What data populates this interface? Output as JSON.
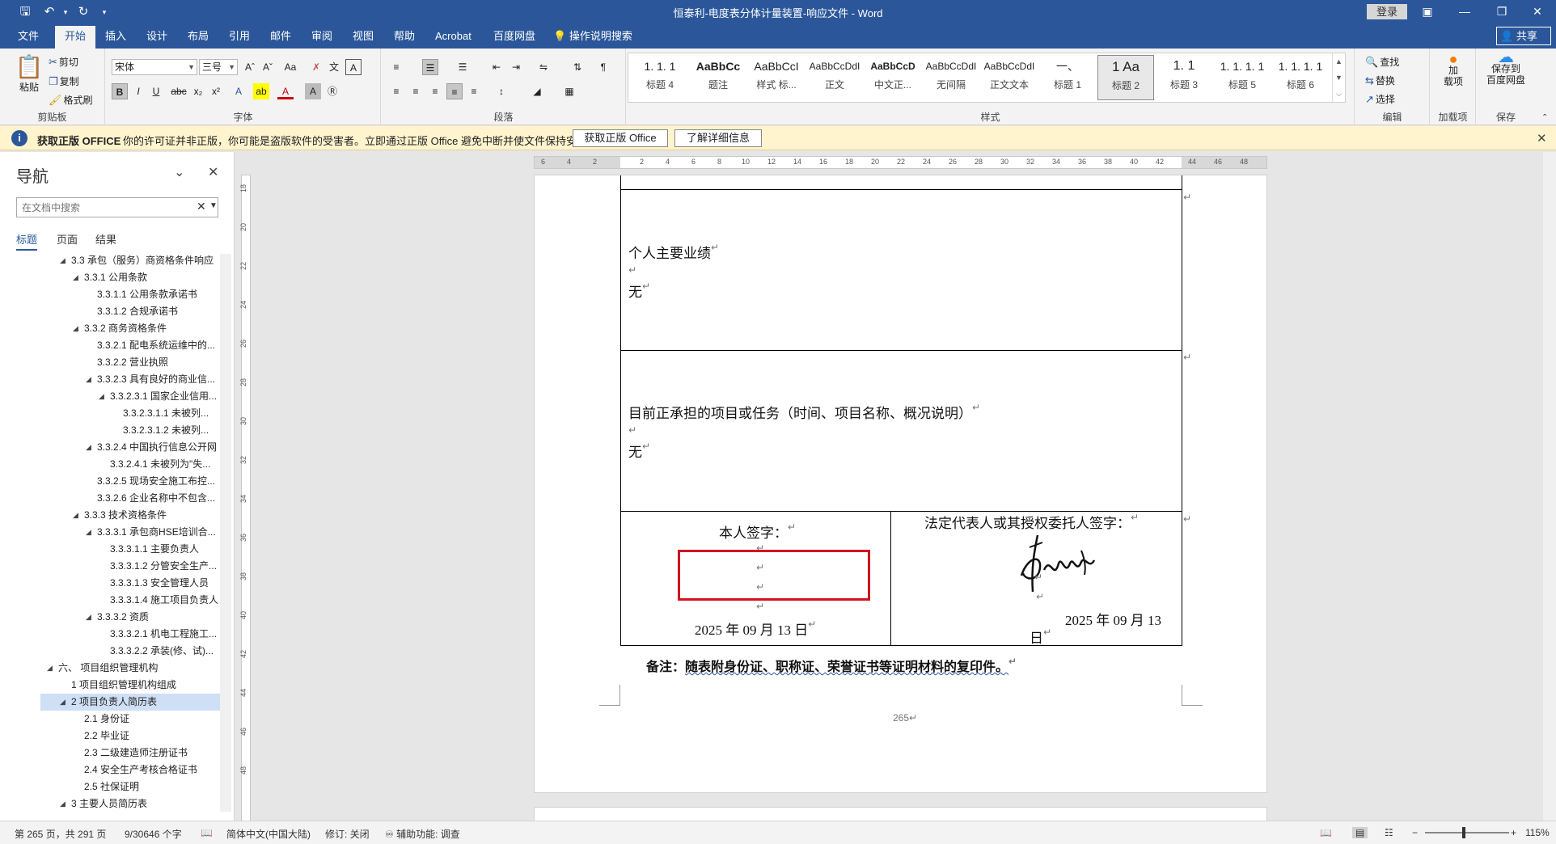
{
  "title": "恒泰利-电度表分体计量装置-响应文件  -  Word",
  "login": "登录",
  "share": "共享",
  "tabs": [
    "文件",
    "开始",
    "插入",
    "设计",
    "布局",
    "引用",
    "邮件",
    "审阅",
    "视图",
    "帮助",
    "Acrobat",
    "百度网盘",
    "操作说明搜索"
  ],
  "ribbon": {
    "clipboard": {
      "paste": "粘贴",
      "cut": "剪切",
      "copy": "复制",
      "painter": "格式刷",
      "label": "剪贴板"
    },
    "font": {
      "name": "宋体",
      "size": "三号",
      "label": "字体"
    },
    "paragraph": {
      "label": "段落"
    },
    "styles": {
      "label": "样式",
      "items": [
        {
          "preview": "1. 1. 1",
          "name": "标题 4"
        },
        {
          "preview": "AaBbCc",
          "name": "题注"
        },
        {
          "preview": "AaBbCcI",
          "name": "样式 标..."
        },
        {
          "preview": "AaBbCcDdI",
          "name": "正文"
        },
        {
          "preview": "AaBbCcD",
          "name": "中文正..."
        },
        {
          "preview": "AaBbCcDdI",
          "name": "无间隔"
        },
        {
          "preview": "AaBbCcDdI",
          "name": "正文文本"
        },
        {
          "preview": "一、",
          "name": "标题 1"
        },
        {
          "preview": "1  Aa",
          "name": "标题 2"
        },
        {
          "preview": "1. 1",
          "name": "标题 3"
        },
        {
          "preview": "1. 1. 1. 1",
          "name": "标题 5"
        },
        {
          "preview": "1. 1. 1. 1",
          "name": "标题 6"
        }
      ]
    },
    "editing": {
      "find": "查找",
      "replace": "替换",
      "select": "选择",
      "label": "编辑"
    },
    "addins": {
      "button": "加\n载项",
      "label": "加载项"
    },
    "save": {
      "button": "保存到\n百度网盘",
      "label": "保存"
    }
  },
  "infobar": {
    "title": "获取正版 OFFICE",
    "message": "你的许可证并非正版，你可能是盗版软件的受害者。立即通过正版 Office 避免中断并使文件保持安全。",
    "btn1": "获取正版 Office",
    "btn2": "了解详细信息"
  },
  "nav": {
    "title": "导航",
    "search_placeholder": "在文档中搜索",
    "tabs": [
      "标题",
      "页面",
      "结果"
    ],
    "items": [
      {
        "t": "3.3 承包（服务）商资格条件响应",
        "lv": 1,
        "tri": true
      },
      {
        "t": "3.3.1 公用条款",
        "lv": 2,
        "tri": true
      },
      {
        "t": "3.3.1.1 公用条款承诺书",
        "lv": 3,
        "tri": false
      },
      {
        "t": "3.3.1.2 合规承诺书",
        "lv": 3,
        "tri": false
      },
      {
        "t": "3.3.2 商务资格条件",
        "lv": 2,
        "tri": true
      },
      {
        "t": "3.3.2.1 配电系统运维中的...",
        "lv": 3,
        "tri": false
      },
      {
        "t": "3.3.2.2 营业执照",
        "lv": 3,
        "tri": false
      },
      {
        "t": "3.3.2.3 具有良好的商业信...",
        "lv": 3,
        "tri": true
      },
      {
        "t": "3.3.2.3.1 国家企业信用...",
        "lv": 4,
        "tri": true
      },
      {
        "t": "3.3.2.3.1.1 未被列...",
        "lv": 5,
        "tri": false
      },
      {
        "t": "3.3.2.3.1.2 未被列...",
        "lv": 5,
        "tri": false
      },
      {
        "t": "3.3.2.4 中国执行信息公开网",
        "lv": 3,
        "tri": true
      },
      {
        "t": "3.3.2.4.1 未被列为\"失...",
        "lv": 4,
        "tri": false
      },
      {
        "t": "3.3.2.5 现场安全施工布控...",
        "lv": 3,
        "tri": false
      },
      {
        "t": "3.3.2.6 企业名称中不包含...",
        "lv": 3,
        "tri": false
      },
      {
        "t": "3.3.3 技术资格条件",
        "lv": 2,
        "tri": true
      },
      {
        "t": "3.3.3.1 承包商HSE培训合...",
        "lv": 3,
        "tri": true
      },
      {
        "t": "3.3.3.1.1 主要负责人",
        "lv": 4,
        "tri": false
      },
      {
        "t": "3.3.3.1.2 分管安全生产...",
        "lv": 4,
        "tri": false
      },
      {
        "t": "3.3.3.1.3 安全管理人员",
        "lv": 4,
        "tri": false
      },
      {
        "t": "3.3.3.1.4 施工项目负责人",
        "lv": 4,
        "tri": false
      },
      {
        "t": "3.3.3.2 资质",
        "lv": 3,
        "tri": true
      },
      {
        "t": "3.3.3.2.1 机电工程施工...",
        "lv": 4,
        "tri": false
      },
      {
        "t": "3.3.3.2.2 承装(修、试)...",
        "lv": 4,
        "tri": false
      },
      {
        "t": "六、 项目组织管理机构",
        "lv": 0,
        "tri": true
      },
      {
        "t": "1 项目组织管理机构组成",
        "lv": 1,
        "tri": false
      },
      {
        "t": "2 项目负责人简历表",
        "lv": 1,
        "tri": true,
        "sel": true
      },
      {
        "t": "2.1 身份证",
        "lv": 2,
        "tri": false
      },
      {
        "t": "2.2 毕业证",
        "lv": 2,
        "tri": false
      },
      {
        "t": "2.3 二级建造师注册证书",
        "lv": 2,
        "tri": false
      },
      {
        "t": "2.4 安全生产考核合格证书",
        "lv": 2,
        "tri": false
      },
      {
        "t": "2.5 社保证明",
        "lv": 2,
        "tri": false
      },
      {
        "t": "3 主要人员简历表",
        "lv": 1,
        "tri": true
      }
    ]
  },
  "doc": {
    "achievements": "个人主要业绩",
    "none": "无",
    "current": "目前正承担的项目或任务（时间、项目名称、概况说明）",
    "sign_self": "本人签字：",
    "sign_legal": "法定代表人或其授权委托人签字：",
    "date_left": "2025 年 09 月 13 日",
    "date_right_1": "2025 年 09 月 13",
    "date_right_2": "日",
    "note_prefix": "备注：",
    "note_body": "随表附身份证、职称证、荣誉证书等证明材料的复印件。",
    "page_number": "265"
  },
  "status": {
    "page": "第 265 页，共 291 页",
    "words": "9/30646 个字",
    "lang": "简体中文(中国大陆)",
    "track": "修订: 关闭",
    "access": "辅助功能: 调查",
    "zoom": "115%"
  },
  "colors": {
    "brand": "#2b579a",
    "highlight": "#d1141d",
    "infobar": "#fff4ce"
  }
}
